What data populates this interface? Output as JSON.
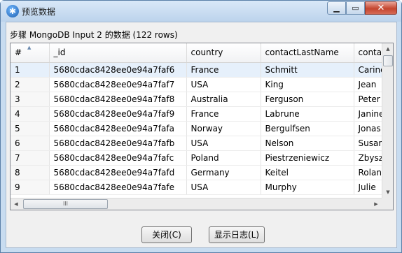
{
  "window": {
    "title": "预览数据",
    "app_icon": "kettle-icon",
    "controls": {
      "minimize": "▁",
      "maximize": "▭",
      "close": "✕"
    }
  },
  "step_label": "步骤 MongoDB Input 2 的数据  (122 rows)",
  "table": {
    "columns": [
      "#",
      "_id",
      "country",
      "contactLastName",
      "contac"
    ],
    "rows": [
      [
        "1",
        "5680cdac8428ee0e94a7faf6",
        "France",
        "Schmitt",
        "Carine"
      ],
      [
        "2",
        "5680cdac8428ee0e94a7faf7",
        "USA",
        "King",
        "Jean"
      ],
      [
        "3",
        "5680cdac8428ee0e94a7faf8",
        "Australia",
        "Ferguson",
        "Peter"
      ],
      [
        "4",
        "5680cdac8428ee0e94a7faf9",
        "France",
        "Labrune",
        "Janine"
      ],
      [
        "5",
        "5680cdac8428ee0e94a7fafa",
        "Norway",
        "Bergulfsen",
        "Jonas"
      ],
      [
        "6",
        "5680cdac8428ee0e94a7fafb",
        "USA",
        "Nelson",
        "Susan"
      ],
      [
        "7",
        "5680cdac8428ee0e94a7fafc",
        "Poland",
        "Piestrzeniewicz",
        "Zbyszek"
      ],
      [
        "8",
        "5680cdac8428ee0e94a7fafd",
        "Germany",
        "Keitel",
        "Roland"
      ],
      [
        "9",
        "5680cdac8428ee0e94a7fafe",
        "USA",
        "Murphy",
        "Julie"
      ]
    ],
    "selected_row": 1
  },
  "scrollbars": {
    "up_arrow": "▲",
    "down_arrow": "▼",
    "left_arrow": "◀",
    "right_arrow": "▶",
    "grip": "III"
  },
  "buttons": {
    "close": "关闭(C)",
    "show_log": "显示日志(L)"
  }
}
